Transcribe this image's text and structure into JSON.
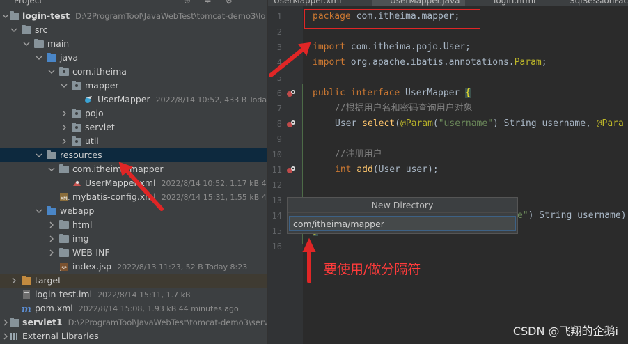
{
  "project_panel": {
    "title": "Project",
    "tree": [
      {
        "label": "login-test",
        "path": "D:\\2ProgramTool\\JavaWebTest\\tomcat-demo3\\lo",
        "bold": true
      },
      {
        "label": "src"
      },
      {
        "label": "main"
      },
      {
        "label": "java"
      },
      {
        "label": "com.itheima"
      },
      {
        "label": "mapper"
      },
      {
        "label": "UserMapper",
        "meta": "2022/8/14 10:52, 433 B Today 1"
      },
      {
        "label": "pojo"
      },
      {
        "label": "servlet"
      },
      {
        "label": "util"
      },
      {
        "label": "resources"
      },
      {
        "label": "com.itheima.mapper"
      },
      {
        "label": "UserMapper.xml",
        "meta": "2022/8/14 10:52, 1.17 kB 40 mi"
      },
      {
        "label": "mybatis-config.xml",
        "meta": "2022/8/14 15:31, 1.55 kB 42 min"
      },
      {
        "label": "webapp"
      },
      {
        "label": "html"
      },
      {
        "label": "img"
      },
      {
        "label": "WEB-INF"
      },
      {
        "label": "index.jsp",
        "meta": "2022/8/13 11:23, 52 B Today 8:23"
      },
      {
        "label": "target"
      },
      {
        "label": "login-test.iml",
        "meta": "2022/8/14 15:11, 1.7 kB"
      },
      {
        "label": "pom.xml",
        "meta": "2022/8/14 15:08, 1.93 kB 44 minutes ago"
      },
      {
        "label": "servlet1",
        "path": "D:\\2ProgramTool\\JavaWebTest\\tomcat-demo3\\serv",
        "bold": true
      },
      {
        "label": "External Libraries"
      }
    ]
  },
  "tabs": [
    "UserMapper.xml",
    "UserMapper.java",
    "login.html",
    "SqlSessionFac"
  ],
  "editor": {
    "line_numbers": [
      "1",
      "2",
      "3",
      "4",
      "5",
      "6",
      "7",
      "8",
      "9",
      "10",
      "11",
      "12",
      "13",
      "14",
      "15",
      "16"
    ],
    "code": {
      "l1_kw": "package",
      "l1_rest": " com.itheima.mapper;",
      "l3_kw": "import",
      "l3_rest": " com.itheima.pojo.User;",
      "l4_kw": "import",
      "l4_rest": " org.apache.ibatis.annotations.",
      "l4_ann": "Param",
      "l4_end": ";",
      "l6_kw": "public interface",
      "l6_rest": " UserMapper ",
      "l6_brace": "{",
      "l7_comment": "//根据用户名和密码查询用户对象",
      "l8_type": "User ",
      "l8_fn": "select",
      "l8_p1": "(",
      "l8_ann": "@Param",
      "l8_p2": "(",
      "l8_str": "\"username\"",
      "l8_rest": ") String username, ",
      "l8_ann2": "@Para",
      "l10_comment": "//注册用户",
      "l11_kw": "int",
      "l11_fn": " add",
      "l11_rest": "(User user);",
      "l14_str": "e\"",
      "l14_rest": ") String username)",
      "l15_brace": "}"
    }
  },
  "dialog": {
    "title": "New Directory",
    "value": "com/itheima/mapper"
  },
  "annotation_note": "要使用/做分隔符",
  "watermark": "CSDN @飞翔的企鹅i",
  "colors": {
    "annotation_red": "#e02626",
    "selection": "#0d293e",
    "keyword": "#cc7832"
  }
}
